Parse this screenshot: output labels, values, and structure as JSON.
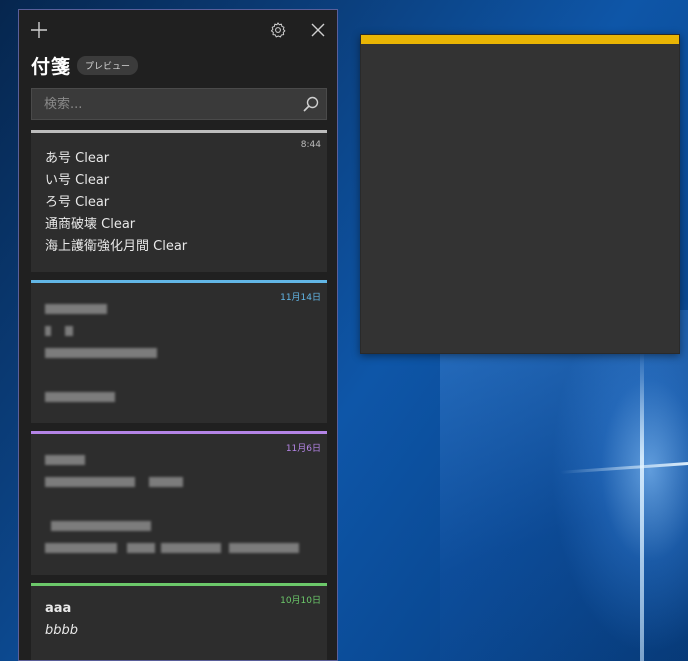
{
  "window": {
    "title": "付箋",
    "badge": "プレビュー",
    "add_icon": "plus-icon",
    "settings_icon": "gear-icon",
    "close_icon": "close-icon"
  },
  "search": {
    "placeholder": "検索...",
    "value": "",
    "icon": "search-icon"
  },
  "notes": [
    {
      "color": "#bdbdbd",
      "time_color": "#bdbdbd",
      "time": "8:44",
      "lines": [
        "あ号 Clear",
        "い号 Clear",
        "ろ号 Clear",
        "通商破壊 Clear",
        "海上護衛強化月間 Clear"
      ]
    },
    {
      "color": "#62b6e6",
      "time_color": "#62b6e6",
      "time": "11月14日",
      "redacted": true
    },
    {
      "color": "#b484e6",
      "time_color": "#b484e6",
      "time": "11月6日",
      "redacted": true
    },
    {
      "color": "#6cc86a",
      "time_color": "#6cc86a",
      "time": "10月10日",
      "lines": [
        "aaa",
        "bbbb"
      ]
    }
  ],
  "sticky_note": {
    "color": "#e9b504",
    "content": ""
  }
}
